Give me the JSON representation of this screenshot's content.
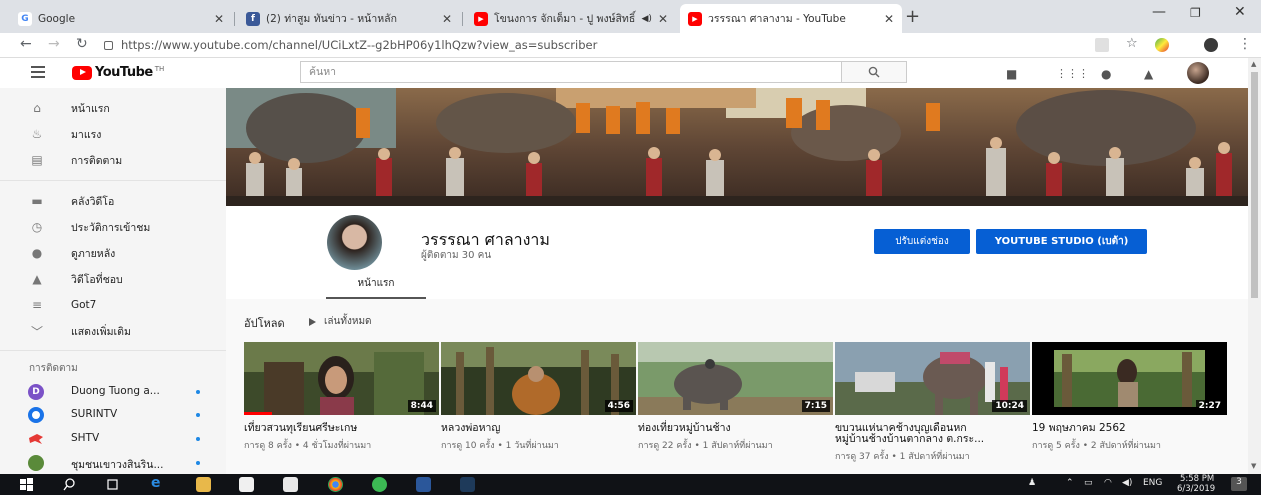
{
  "browser": {
    "tabs": [
      {
        "title": "Google",
        "favicon": "G",
        "color": "#4285f4"
      },
      {
        "title": "(2) ท่าสูม ทันข่าว - หน้าหลัก",
        "favicon": "f",
        "color": "#3b5998"
      },
      {
        "title": "โขนงการ จักเต็มา - ปู พงษ์สิทธิ์ คำ",
        "favicon": "▶",
        "color": "#ff0000"
      },
      {
        "title": "วรรรณา ศาลางาม - YouTube",
        "favicon": "▶",
        "color": "#ff0000"
      }
    ],
    "url": "https://www.youtube.com/channel/UCiLxtZ--g2bHP06y1lhQzw?view_as=subscriber"
  },
  "youtube": {
    "logo": "YouTube",
    "tm": "TH",
    "search_placeholder": "ค้นหา"
  },
  "sidebar": {
    "items": [
      {
        "label": "หน้าแรก",
        "icon": "home-icon"
      },
      {
        "label": "มาแรง",
        "icon": "fire-icon"
      },
      {
        "label": "การติดตาม",
        "icon": "subscriptions-icon"
      },
      {
        "label": "คลังวิดีโอ",
        "icon": "library-icon"
      },
      {
        "label": "ประวัติการเข้าชม",
        "icon": "history-icon"
      },
      {
        "label": "ดูภายหลัง",
        "icon": "clock-icon"
      },
      {
        "label": "วิดีโอที่ชอบ",
        "icon": "like-icon"
      },
      {
        "label": "Got7",
        "icon": "playlist-icon"
      },
      {
        "label": "แสดงเพิ่มเติม",
        "icon": "chevron-down-icon"
      }
    ],
    "subs_header": "การติดตาม",
    "subscriptions": [
      {
        "label": "Duong Tuong a...",
        "avatar": "D",
        "color": "#7b52c7"
      },
      {
        "label": "SURINTV",
        "avatar": "",
        "color": "#1a73e8"
      },
      {
        "label": "SHTV",
        "avatar": "",
        "color": "#e53935"
      },
      {
        "label": "ชุมชนเขาวงสินริน...",
        "avatar": "",
        "color": "#5a8a3a"
      }
    ]
  },
  "channel": {
    "name": "วรรรณา ศาลางาม",
    "subscribers": "ผู้ติดตาม 30 คน",
    "customize_label": "ปรับแต่งช่อง",
    "studio_label": "YOUTUBE STUDIO (เบต้า)",
    "tab_home": "หน้าแรก"
  },
  "uploads": {
    "title": "อัปโหลด",
    "play_all": "เล่นทั้งหมด",
    "videos": [
      {
        "title": "เที่ยวสวนทุเรียนศรีษะเกษ",
        "meta": "การดู 8 ครั้ง • 4 ชั่วโมงที่ผ่านมา",
        "duration": "8:44"
      },
      {
        "title": "หลวงพ่อหาญ",
        "meta": "การดู 10 ครั้ง • 1 วันที่ผ่านมา",
        "duration": "4:56"
      },
      {
        "title": "ท่องเที่ยวหมู่บ้านช้าง",
        "meta": "การดู 22 ครั้ง • 1 สัปดาห์ที่ผ่านมา",
        "duration": "7:15"
      },
      {
        "title": "ขบวนแห่นาคช้างบุญเดือนหก\nหมู่บ้านช้างบ้านตากลาง ต.กระ...",
        "meta": "การดู 37 ครั้ง • 1 สัปดาห์ที่ผ่านมา",
        "duration": "10:24"
      },
      {
        "title": "19 พฤษภาคม 2562",
        "meta": "การดู 5 ครั้ง • 2 สัปดาห์ที่ผ่านมา",
        "duration": "2:27"
      }
    ]
  },
  "taskbar": {
    "lang": "ENG",
    "time": "5:58 PM",
    "date": "6/3/2019",
    "notif": "3"
  }
}
